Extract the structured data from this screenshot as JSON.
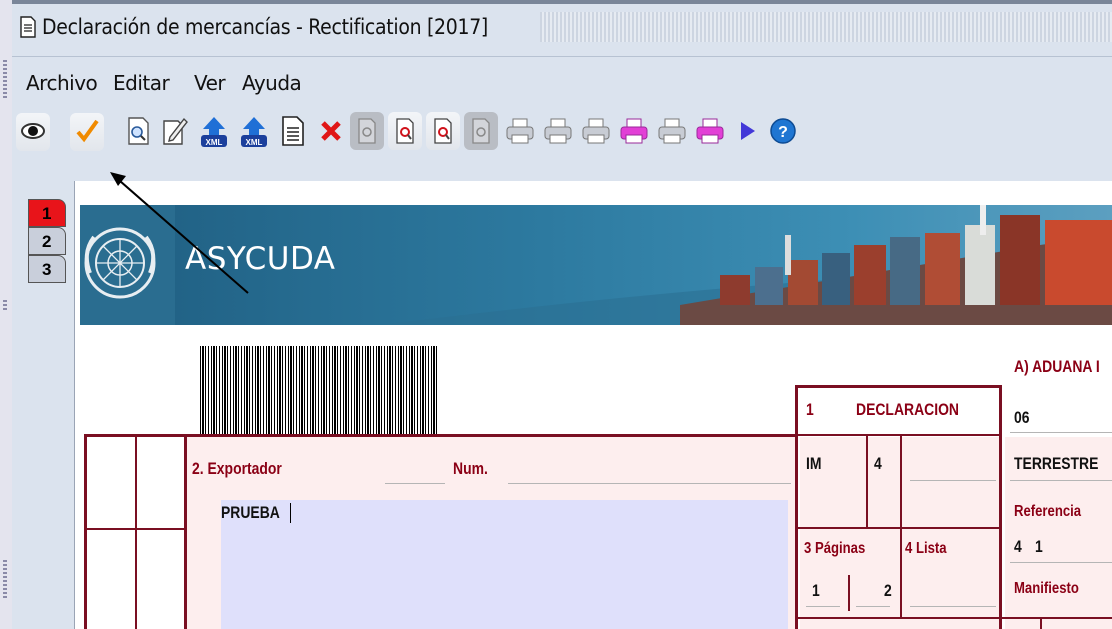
{
  "window": {
    "title": "Declaración de mercancías - Rectification [2017]"
  },
  "menu": [
    "Archivo",
    "Editar",
    "Ver",
    "Ayuda"
  ],
  "toolbar": {
    "buttons": [
      "eye-icon",
      "check-icon",
      "zoom-icon",
      "edit-icon",
      "xml-upload-icon",
      "xml-upload-icon",
      "document-icon",
      "delete-icon",
      "preview-disabled-icon",
      "preview-icon",
      "preview-icon",
      "preview-disabled-icon",
      "print-icon",
      "print-icon",
      "print-pink-icon",
      "print-icon",
      "print-pink-icon",
      "play-icon",
      "help-icon"
    ]
  },
  "tabs": [
    {
      "label": "1",
      "active": true
    },
    {
      "label": "2",
      "active": false
    },
    {
      "label": "3",
      "active": false
    }
  ],
  "banner": {
    "text": "ASYCUDA"
  },
  "form": {
    "aduana_label": "A) ADUANA I",
    "declaracion_num": "1",
    "declaracion_label": "DECLARACION",
    "exportador_label": "2. Exportador",
    "num_label": "Num.",
    "exportador_value": "PRUEBA",
    "im_value": "IM",
    "four_value": "4",
    "paginas_label": "3 Páginas",
    "lista_label": "4 Lista",
    "paginas_value_1": "1",
    "paginas_value_2": "2",
    "aduana_code": "06",
    "terrestre_value": "TERRESTRE",
    "referencia_label": "Referencia",
    "ref_value_1": "4",
    "ref_value_2": "1",
    "manifiesto_label": "Manifiesto"
  },
  "colors": {
    "accent_red": "#8b0015",
    "tab_active": "#e8141a",
    "field_fill": "#dfe0fb",
    "chrome": "#dbe3ee"
  }
}
